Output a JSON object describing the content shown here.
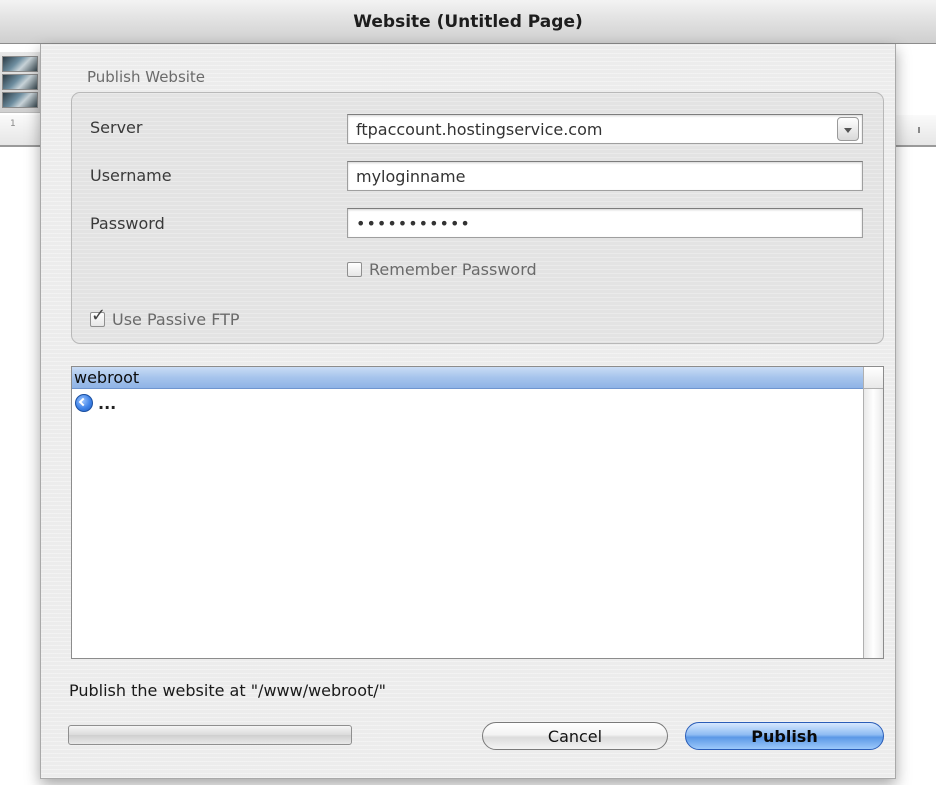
{
  "window": {
    "title": "Website (Untitled Page)"
  },
  "background": {
    "ruler_tick": "1"
  },
  "dialog": {
    "group_title": "Publish Website",
    "server": {
      "label": "Server",
      "value": "ftpaccount.hostingservice.com"
    },
    "username": {
      "label": "Username",
      "value": "myloginname"
    },
    "password": {
      "label": "Password",
      "value": "•••••••••••"
    },
    "remember_password": {
      "label": "Remember Password",
      "checked": false
    },
    "passive_ftp": {
      "label": "Use Passive FTP",
      "checked": true,
      "check_glyph": "✓"
    },
    "browser": {
      "header": "webroot",
      "rows": [
        {
          "icon": "back-arrow-icon",
          "label": "..."
        }
      ]
    },
    "status": "Publish the website at \"/www/webroot/\"",
    "progress": 0,
    "buttons": {
      "cancel": "Cancel",
      "publish": "Publish"
    }
  },
  "colors": {
    "selection_blue": "#8eb3e6",
    "default_button_blue": "#5b98e6",
    "dialog_background": "#ececec"
  }
}
